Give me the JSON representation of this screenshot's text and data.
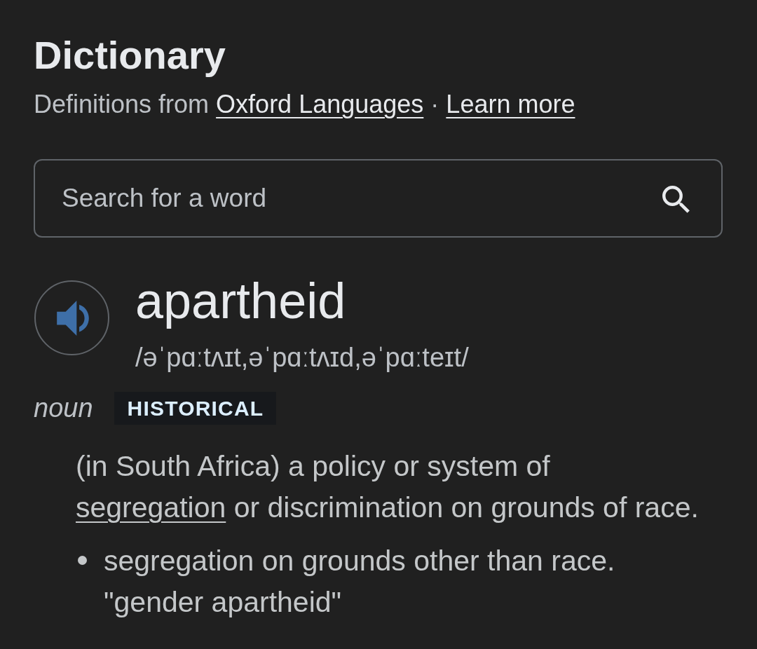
{
  "header": {
    "title": "Dictionary",
    "source": {
      "prefix": "Definitions from",
      "links": [
        {
          "text": "Oxford Languages"
        },
        {
          "text": "Learn more"
        }
      ],
      "separator": "·"
    }
  },
  "search": {
    "placeholder": "Search for a word"
  },
  "entry": {
    "word": "apartheid",
    "phonetic": "/əˈpɑːtʌɪt,əˈpɑːtʌɪd,əˈpɑːteɪt/",
    "part_of_speech": "noun",
    "label": "HISTORICAL",
    "senses": [
      {
        "parts": [
          {
            "kind": "text",
            "text": "(in South Africa) a policy or system of"
          },
          {
            "kind": "link",
            "text": "segregation"
          },
          {
            "kind": "text",
            "text": "or discrimination on grounds of race."
          }
        ],
        "subsenses": [
          {
            "definition": "segregation on grounds other than race.",
            "example": "\"gender apartheid\""
          }
        ]
      }
    ]
  }
}
